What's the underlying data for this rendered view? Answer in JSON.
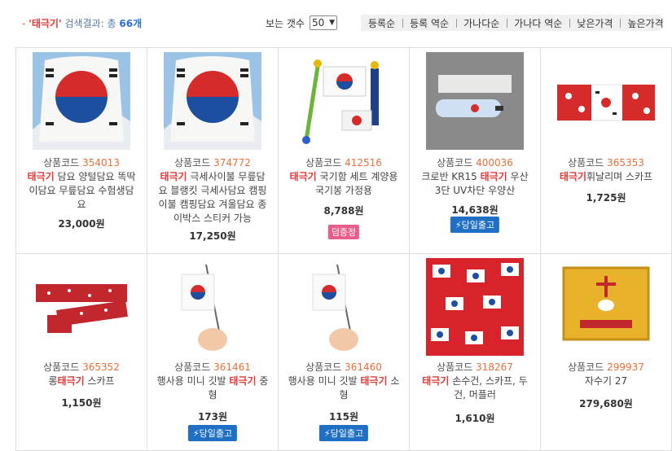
{
  "summary": {
    "dash": "-",
    "keyword": "'태극기'",
    "label": "검색결과: 총",
    "count": "66",
    "unit": "개"
  },
  "per_page": {
    "label": "보는 갯수",
    "value": "50"
  },
  "sort_options": [
    "등록순",
    "등록 역순",
    "가나다순",
    "가나다 역순",
    "낮은가격",
    "높은가격"
  ],
  "code_label": "상품코드",
  "same_day_label": "⚡당일출고",
  "gift_label": "덤증정",
  "products": [
    {
      "code": "354013",
      "kw": "태극기",
      "rest": " 담요 양털담요 똑딱이담요 무릎담요 수험생담요",
      "price": "23,000원"
    },
    {
      "code": "374772",
      "kw": "태극기",
      "rest": " 극세사이불 무릎담요 블랭킷 극세사담요 캠핑이불 캠핑담요 겨울담요 종이박스 스티커 가능",
      "price": "17,250원"
    },
    {
      "code": "412516",
      "kw": "태극기",
      "rest": " 국기함 세트 계양용 국기봉 가정용",
      "price": "8,788원"
    },
    {
      "pre": "크로반 KR15 ",
      "code": "400036",
      "kw": "태극기",
      "rest": " 우산 3단 UV차단 우양산",
      "price": "14,638원"
    },
    {
      "code": "365353",
      "kw": "태극기",
      "rest": "휘날리며 스카프",
      "price": "1,725원"
    },
    {
      "pre": "롱",
      "code": "365352",
      "kw": "태극기",
      "rest": " 스카프",
      "price": "1,150원"
    },
    {
      "pre": "행사용 미니 깃발 ",
      "code": "361461",
      "kw": "태극기",
      "rest": " 중형",
      "price": "173원"
    },
    {
      "pre": "행사용 미니 깃발 ",
      "code": "361460",
      "kw": "태극기",
      "rest": " 소형",
      "price": "115원"
    },
    {
      "code": "318267",
      "kw": "태극기",
      "rest": " 손수건, 스카프, 두건, 머플러",
      "price": "1,610원"
    },
    {
      "code": "299937",
      "name": "자수기 27",
      "price": "279,680원"
    }
  ],
  "colors": {
    "keyword": "#e53935",
    "count": "#2a6fd1",
    "code": "#e8703a",
    "same_day": "#1f6fc5",
    "gift": "#e85d8a"
  }
}
